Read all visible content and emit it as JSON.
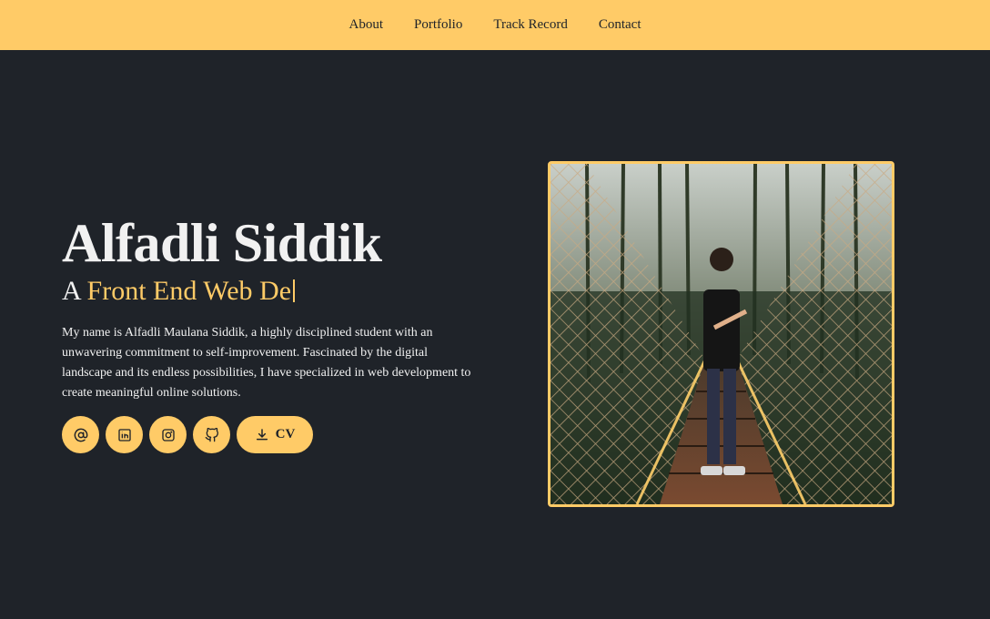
{
  "nav": {
    "items": [
      {
        "label": "About"
      },
      {
        "label": "Portfolio"
      },
      {
        "label": "Track Record"
      },
      {
        "label": "Contact"
      }
    ]
  },
  "hero": {
    "name": "Alfadli Siddik",
    "role_prefix": "A ",
    "role_typed": "Front End Web De",
    "description": "My name is Alfadli Maulana Siddik, a highly disciplined student with an unwavering commitment to self-improvement. Fascinated by the digital landscape and its endless possibilities, I have specialized in web development to create meaningful online solutions."
  },
  "social": {
    "email_icon": "at-sign-icon",
    "linkedin_icon": "linkedin-icon",
    "instagram_icon": "instagram-icon",
    "github_icon": "github-icon",
    "cv_label": "CV",
    "cv_icon": "download-icon"
  },
  "colors": {
    "accent": "#ffcb67",
    "background": "#1f2329",
    "text": "#f1f1f1"
  }
}
